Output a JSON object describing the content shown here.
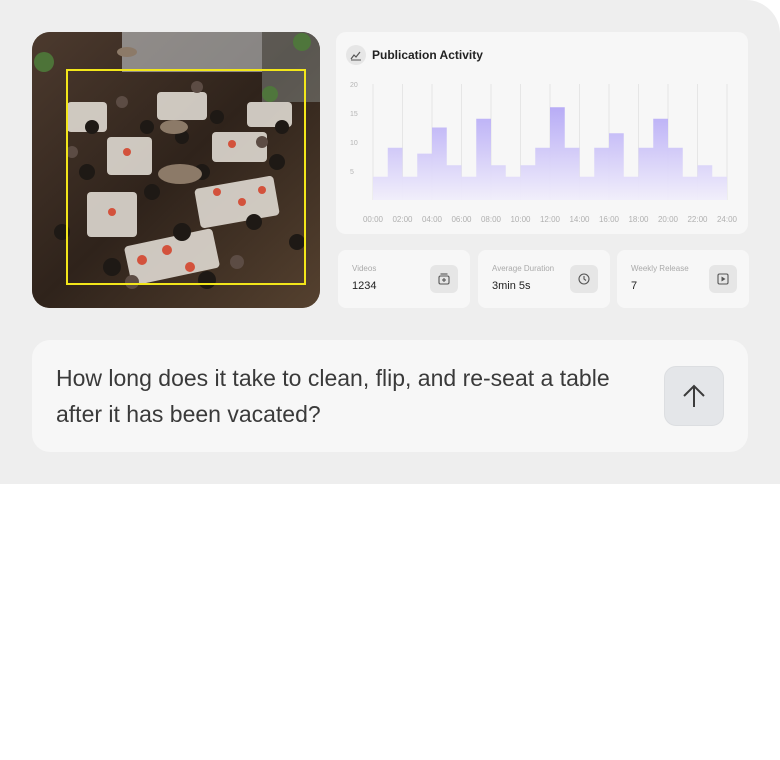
{
  "feed": {
    "icon": "camera-feed-image"
  },
  "chart": {
    "title": "Publication Activity",
    "icon": "chart-icon"
  },
  "chart_data": {
    "type": "area",
    "title": "Publication Activity",
    "xlabel": "",
    "ylabel": "",
    "ylim": [
      0,
      20
    ],
    "y_ticks": [
      "5",
      "10",
      "15",
      "20"
    ],
    "categories": [
      "00:00",
      "02:00",
      "04:00",
      "06:00",
      "08:00",
      "10:00",
      "12:00",
      "14:00",
      "16:00",
      "18:00",
      "20:00",
      "22:00",
      "24:00"
    ],
    "series": [
      {
        "x": [
          0,
          1,
          2,
          3,
          4,
          5,
          6,
          7,
          8,
          9,
          10,
          11,
          12,
          13,
          14,
          15,
          16,
          17,
          18,
          19,
          20,
          21,
          22,
          23
        ],
        "values": [
          4,
          9,
          4,
          8,
          12.5,
          6,
          4,
          14,
          6,
          4,
          6,
          9,
          16,
          9,
          4,
          9,
          11.5,
          4,
          9,
          14,
          9,
          4,
          6,
          4
        ]
      }
    ],
    "colors": {
      "fill_top": "#b4a8f6",
      "fill_bottom": "#f1eefb"
    },
    "grid": "vertical"
  },
  "stats": [
    {
      "label": "Videos",
      "value": "1234",
      "icon": "video-add-icon"
    },
    {
      "label": "Average Duration",
      "value": "3min 5s",
      "icon": "clock-icon"
    },
    {
      "label": "Weekly Release",
      "value": "7",
      "icon": "play-icon"
    }
  ],
  "question": {
    "text": "How long does it take to clean, flip, and re-seat a table after it has been vacated?",
    "send_icon": "arrow-up-icon"
  }
}
